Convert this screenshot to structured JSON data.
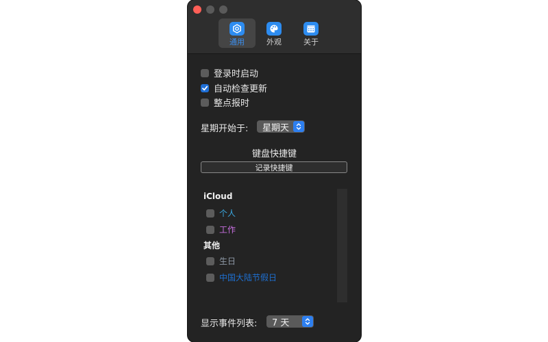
{
  "window": {
    "tabs": [
      {
        "label": "通用",
        "icon": "gear-icon",
        "active": true
      },
      {
        "label": "外观",
        "icon": "palette-icon",
        "active": false
      },
      {
        "label": "关于",
        "icon": "calendar-icon",
        "active": false
      }
    ]
  },
  "general": {
    "options": [
      {
        "label": "登录时启动",
        "checked": false
      },
      {
        "label": "自动检查更新",
        "checked": true
      },
      {
        "label": "整点报时",
        "checked": false
      }
    ],
    "week_start_label": "星期开始于:",
    "week_start_value": "星期天",
    "shortcut_title": "键盘快捷键",
    "record_shortcut_button": "记录快捷键",
    "calendars": {
      "icloud_title": "iCloud",
      "icloud_items": [
        {
          "label": "个人",
          "color": "#3aa7e0",
          "checked": false
        },
        {
          "label": "工作",
          "color": "#c86fe0",
          "checked": false
        }
      ],
      "other_title": "其他",
      "other_items": [
        {
          "label": "生日",
          "color": "#8e99a6",
          "checked": false
        },
        {
          "label": "中国大陆节假日",
          "color": "#1e6fd0",
          "checked": false
        }
      ]
    },
    "event_list_label": "显示事件列表:",
    "event_list_value": "7 天"
  },
  "colors": {
    "accent": "#2d8cf0",
    "close": "#ff5f57",
    "window_bg": "#232323"
  }
}
